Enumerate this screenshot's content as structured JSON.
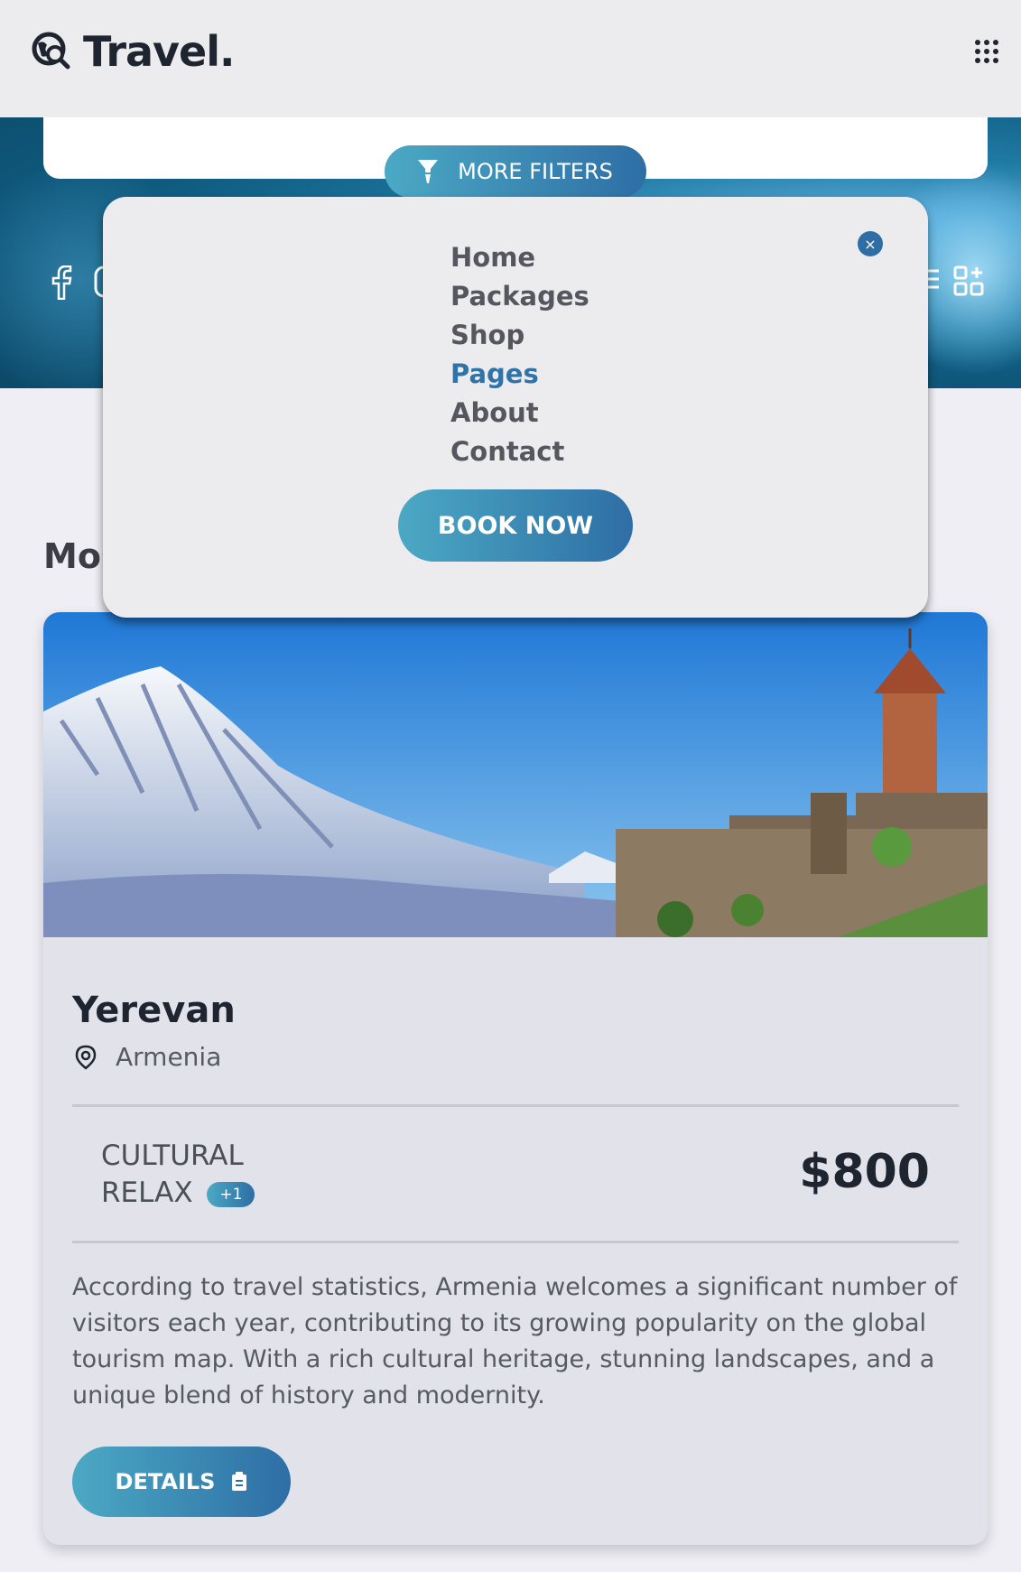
{
  "header": {
    "brand": "Travel."
  },
  "hero": {
    "more_filters_label": "MORE FILTERS"
  },
  "section": {
    "title_visible": "Mos"
  },
  "nav_menu": {
    "items": [
      {
        "label": "Home",
        "active": false
      },
      {
        "label": "Packages",
        "active": false
      },
      {
        "label": "Shop",
        "active": false
      },
      {
        "label": "Pages",
        "active": true
      },
      {
        "label": "About",
        "active": false
      },
      {
        "label": "Contact",
        "active": false
      }
    ],
    "book_label": "BOOK NOW",
    "close_symbol": "×"
  },
  "card": {
    "city": "Yerevan",
    "country": "Armenia",
    "tag_line1": "CULTURAL",
    "tag_line2": "RELAX",
    "tag_extra": "+1",
    "price": "$800",
    "description": "According to travel statistics, Armenia welcomes a significant number of visitors each year, contributing to its growing popularity on the global tourism map. With a rich cultural heritage, stunning landscapes, and a unique blend of history and modernity.",
    "details_label": "DETAILS"
  },
  "icons": {
    "logo": "globe-search-icon",
    "menu": "grid-menu-icon",
    "filter": "funnel-icon",
    "location": "map-pin-icon",
    "details": "clipboard-icon"
  },
  "colors": {
    "accent_start": "#4ba9c4",
    "accent_end": "#2e6ea5",
    "active_nav": "#2f73a8",
    "dark_text": "#1f2530"
  }
}
